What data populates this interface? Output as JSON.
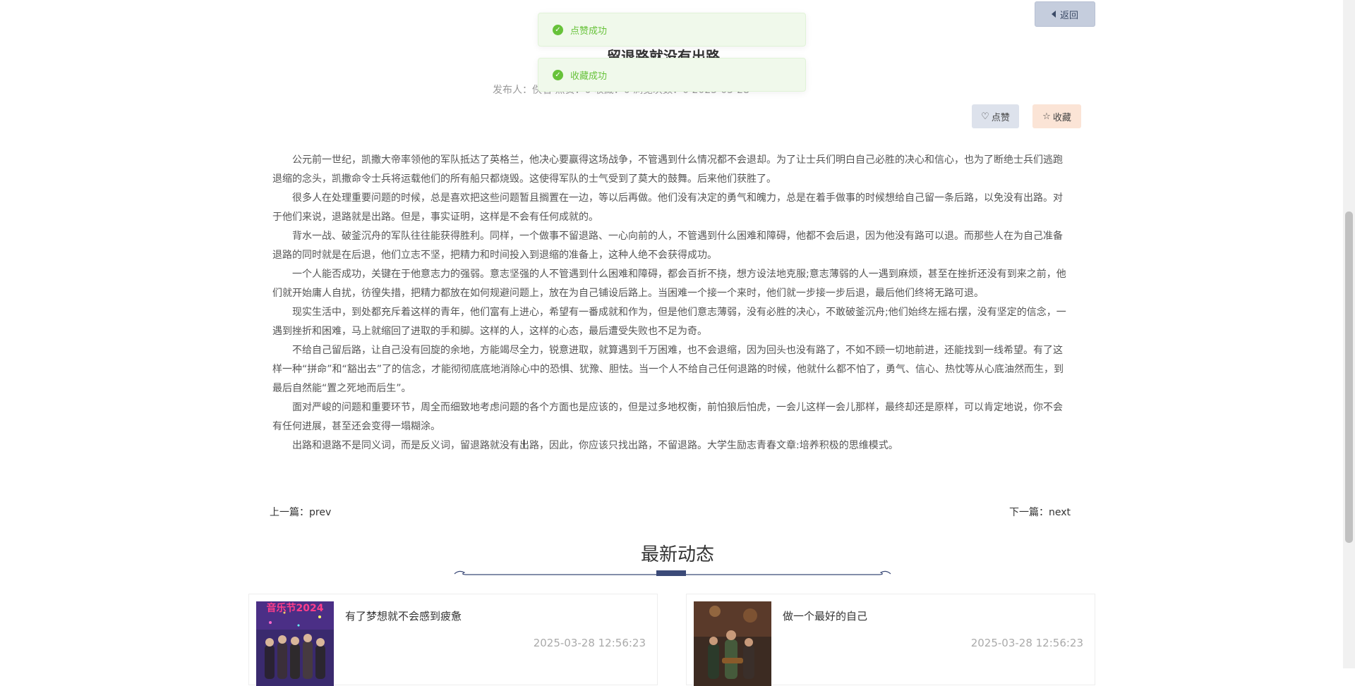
{
  "toasts": [
    {
      "message": "点赞成功"
    },
    {
      "message": "收藏成功"
    }
  ],
  "header": {
    "back_label": "返回",
    "title": "留退路就没有出路",
    "meta": "发布人：佚名  点赞：0  收藏：0  浏览次数：0  2025-03-28"
  },
  "actions": {
    "like_label": "点赞",
    "favorite_label": "收藏"
  },
  "article": {
    "paragraphs": [
      "公元前一世纪，凯撒大帝率领他的军队抵达了英格兰，他决心要赢得这场战争，不管遇到什么情况都不会退却。为了让士兵们明白自己必胜的决心和信心，也为了断绝士兵们逃跑退缩的念头，凯撒命令士兵将运载他们的所有船只都烧毁。这使得军队的士气受到了莫大的鼓舞。后来他们获胜了。",
      "很多人在处理重要问题的时候，总是喜欢把这些问题暂且搁置在一边，等以后再做。他们没有决定的勇气和魄力，总是在着手做事的时候想给自己留一条后路，以免没有出路。对于他们来说，退路就是出路。但是，事实证明，这样是不会有任何成就的。",
      "背水一战、破釜沉舟的军队往往能获得胜利。同样，一个做事不留退路、一心向前的人，不管遇到什么困难和障碍，他都不会后退，因为他没有路可以退。而那些人在为自己准备退路的同时就是在后退，他们立志不坚，把精力和时间投入到退缩的准备上，这种人绝不会获得成功。",
      "一个人能否成功，关键在于他意志力的强弱。意志坚强的人不管遇到什么困难和障碍，都会百折不挠，想方设法地克服;意志薄弱的人一遇到麻烦，甚至在挫折还没有到来之前，他们就开始庸人自扰，彷徨失措，把精力都放在如何规避问题上，放在为自己铺设后路上。当困难一个接一个来时，他们就一步接一步后退，最后他们终将无路可退。",
      "现实生活中，到处都充斥着这样的青年，他们富有上进心，希望有一番成就和作为，但是他们意志薄弱，没有必胜的决心，不敢破釜沉舟;他们始终左摇右摆，没有坚定的信念，一遇到挫折和困难，马上就缩回了进取的手和脚。这样的人，这样的心态，最后遭受失败也不足为奇。",
      "不给自己留后路，让自己没有回旋的余地，方能竭尽全力，锐意进取，就算遇到千万困难，也不会退缩，因为回头也没有路了，不如不顾一切地前进，还能找到一线希望。有了这样一种“拼命”和“豁出去”了的信念，才能彻彻底底地消除心中的恐惧、犹豫、胆怯。当一个人不给自己任何退路的时候，他就什么都不怕了，勇气、信心、热忱等从心底油然而生，到最后自然能“置之死地而后生”。",
      "面对严峻的问题和重要环节，周全而细致地考虑问题的各个方面也是应该的，但是过多地权衡，前怕狼后怕虎，一会儿这样一会儿那样，最终却还是原样，可以肯定地说，你不会有任何进展，甚至还会变得一塌糊涂。",
      "出路和退路不是同义词，而是反义词，留退路就没有出路，因此，你应该只找出路，不留退路。大学生励志青春文章:培养积极的思维模式。"
    ]
  },
  "pager": {
    "prev_text": "上一篇：prev",
    "next_text": "下一篇：next"
  },
  "latest": {
    "heading": "最新动态",
    "items": [
      {
        "title": "有了梦想就不会感到疲惫",
        "time": "2025-03-28 12:56:23",
        "thumb_text": "音乐节2024"
      },
      {
        "title": "做一个最好的自己",
        "time": "2025-03-28 12:56:23"
      }
    ]
  },
  "colors": {
    "success": "#67c23a",
    "accent": "#3b4a78"
  }
}
